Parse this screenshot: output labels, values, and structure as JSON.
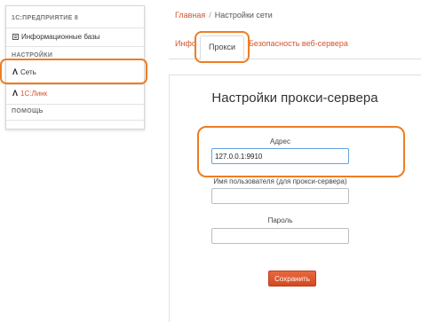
{
  "sidebar": {
    "section1_title": "1С:ПРЕДПРИЯТИЕ 8",
    "infobases_label": "Информационные базы",
    "section2_title": "НАСТРОЙКИ",
    "network_label": "Сеть",
    "link_label": "1С:Линк",
    "section3_title": "ПОМОЩЬ"
  },
  "breadcrumb": {
    "home": "Главная",
    "separator": "/",
    "current": "Настройки сети"
  },
  "tabs": {
    "info": "Инфо",
    "proxy": "Прокси",
    "security": "Безопасность веб-сервера"
  },
  "form": {
    "title": "Настройки прокси-сервера",
    "address_label": "Адрес",
    "address_value": "127.0.0.1:9910",
    "username_label": "Имя пользователя (для прокси-сервера)",
    "username_value": "",
    "password_label": "Пароль",
    "password_value": "",
    "save_label": "Сохранить"
  },
  "colors": {
    "accent": "#d4532b",
    "highlight": "#ef7d22",
    "button": "#e05a30"
  }
}
